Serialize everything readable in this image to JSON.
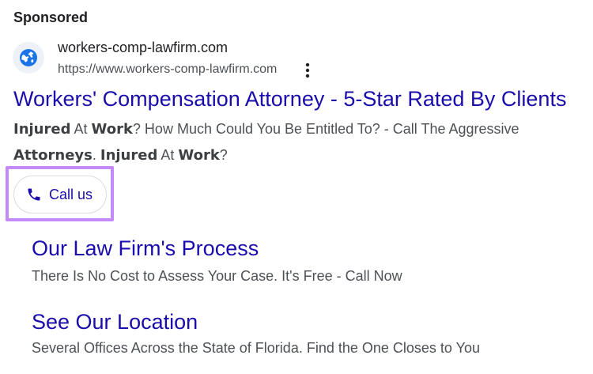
{
  "ad": {
    "sponsored_label": "Sponsored",
    "favicon_icon": "globe-icon",
    "site_name": "workers-comp-lawfirm.com",
    "display_url": "https://www.workers-comp-lawfirm.com",
    "more_menu_icon": "more-vert-icon",
    "headline": "Workers' Compensation Attorney - 5-Star Rated By Clients",
    "description": {
      "line1": {
        "seg1_bold": "Injured",
        "seg2": " At ",
        "seg3_bold": "Work",
        "seg4": "? How Much Could You Be Entitled To? - Call The Aggressive"
      },
      "line2": {
        "seg1_bold": "Attorneys",
        "seg2": ". ",
        "seg3_bold": "Injured",
        "seg4": " At ",
        "seg5_bold": "Work",
        "seg6": "?"
      }
    },
    "call_button": {
      "icon": "phone-icon",
      "label": "Call us"
    },
    "sitelinks": [
      {
        "title": "Our Law Firm's Process",
        "description": "There Is No Cost to Assess Your Case. It's Free - Call Now"
      },
      {
        "title": "See Our Location",
        "description": "Several Offices Across the State of Florida. Find the One Closes to You"
      }
    ]
  },
  "colors": {
    "link_blue": "#1a0dab",
    "text_dark": "#202124",
    "text_gray": "#4d5156",
    "highlight_purple": "#c58af9",
    "favicon_blue": "#1a73e8"
  }
}
